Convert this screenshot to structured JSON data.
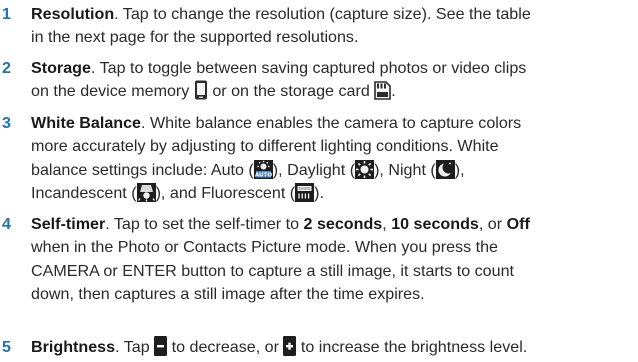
{
  "items": [
    {
      "number": "1",
      "term": "Resolution",
      "lines": [
        ". Tap to change the resolution (capture size). See the table",
        "in the next page for the supported resolutions."
      ]
    },
    {
      "number": "2",
      "term": "Storage",
      "lines": [
        ". Tap to toggle between saving captured photos or video clips",
        "on the device memory",
        "or on the storage card",
        "."
      ],
      "icons": [
        "device-memory-icon",
        "storage-card-icon"
      ]
    },
    {
      "number": "3",
      "term": "White Balance",
      "lines": [
        ". White balance enables the camera to capture colors",
        "more accurately by adjusting to different lighting conditions. White",
        "balance settings include: Auto (",
        "), Daylight (",
        "), Night (",
        "),",
        "Incandescent (",
        "), and Fluorescent (",
        ")."
      ],
      "icons": [
        "auto-wb-icon",
        "daylight-icon",
        "night-icon",
        "incandescent-icon",
        "fluorescent-icon"
      ]
    },
    {
      "number": "4",
      "term": "Self-timer",
      "lines": [
        ". Tap to set the self-timer to ",
        "2 seconds",
        ", ",
        "10 seconds",
        ", or ",
        "Off",
        "when in the Photo or Contacts Picture mode. When you press the",
        "CAMERA or ENTER button to capture a still image, it starts to count",
        "down, then captures a still image after the time expires."
      ]
    },
    {
      "number": "5",
      "term": "Brightness",
      "lines": [
        ". Tap ",
        " to decrease, or ",
        " to increase the brightness level."
      ],
      "icons": [
        "minus-icon",
        "plus-icon"
      ]
    }
  ],
  "colors": {
    "number": "#1f72b8",
    "text": "#2a2a2a"
  }
}
